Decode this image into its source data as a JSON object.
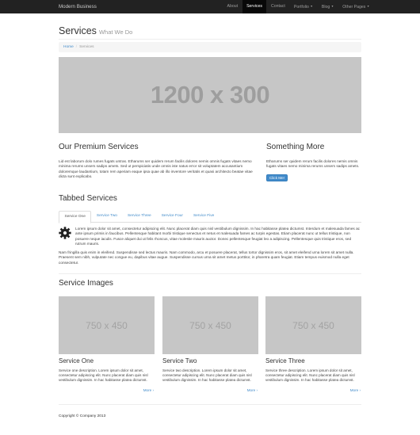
{
  "navbar": {
    "brand": "Modern Business",
    "links": [
      {
        "label": "About"
      },
      {
        "label": "Services"
      },
      {
        "label": "Contact"
      },
      {
        "label": "Portfolio"
      },
      {
        "label": "Blog"
      },
      {
        "label": "Other Pages"
      }
    ]
  },
  "header": {
    "title": "Services",
    "subtitle": "What We Do"
  },
  "breadcrumb": {
    "home": "Home",
    "current": "Services"
  },
  "hero": {
    "placeholder": "1200 x 300"
  },
  "premium": {
    "title": "Our Premium Services",
    "text": "Lid est laborum dolo rumes fugats untras. Etharums ser quidem rerum facilis dolores nemis omnis fugats vitaes nemo minima rerums unsers sadips amets. Sed ut perspiciatis unde omnis iste natus error sit voluptatem accusantium doloremque laudantium, totam rem aperiam eaque ipsa quae ab illo inventore veritatis et quasi architecto beatae vitae dicta sunt explicabo."
  },
  "something": {
    "title": "Something More",
    "text": "Etharums ser quidem rerum facilis dolores nemis omnis fugats vitaes nemo minima rerums unsers sadips amets.",
    "button": "Click Me!"
  },
  "tabbed": {
    "title": "Tabbed Services",
    "tabs": [
      "Service One",
      "Service Two",
      "Service Three",
      "Service Four",
      "Service Five"
    ],
    "para1": "Lorem ipsum dolor sit amet, consectetur adipiscing elit. Nunc placerat diam quis nisl vestibulum dignissim. In hac habitasse platea dictumst. Interdum et malesuada fames ac ante ipsum primis in faucibus. Pellentesque habitant morbi tristique senectus et netus et malesuada fames ac turpis egestas. Etiam placerat nunc ut tellus tristique, non posuere neque iaculis. Fusce aliquet dui ut felis rhoncus, vitae molestie mauris auctor. Donec pellentesque feugiat leo a adipiscing. Pellentesque quis tristique eros, sed rutrum mauris.",
    "para2": "Nam fringilla quis enim in eleifend. Suspendisse sed lectus mauris. Nam commodo, arcu et posuere placerat, tellus tortor dignissim eros, sit amet eleifend urna lorem sit amet nulla. Praesent sem nibh, vulputate nec congue eu, dapibus vitae augue. Suspendisse cursus urna sit amet metus porttitor, in pharetra quam feugiat. Etiam tempus euismod nulla eget consectetur."
  },
  "images": {
    "title": "Service Images",
    "cards": [
      {
        "placeholder": "750 x 450",
        "title": "Service One",
        "text": "Service one description. Lorem ipsum dolor sit amet, consectetur adipiscing elit. Nunc placerat diam quis nisl vestibulum dignissim. In hac habitasse platea dictumst.",
        "more": "More ›"
      },
      {
        "placeholder": "750 x 450",
        "title": "Service Two",
        "text": "Service two description. Lorem ipsum dolor sit amet, consectetur adipiscing elit. Nunc placerat diam quis nisl vestibulum dignissim. In hac habitasse platea dictumst.",
        "more": "More ›"
      },
      {
        "placeholder": "750 x 450",
        "title": "Service Three",
        "text": "Service three description. Lorem ipsum dolor sit amet, consectetur adipiscing elit. Nunc placerat diam quis nisl vestibulum dignissim. In hac habitasse platea dictumst.",
        "more": "More ›"
      }
    ]
  },
  "footer": {
    "copyright": "Copyright © Company 2013"
  },
  "colors": {
    "navbar": "#222222",
    "link": "#428bca",
    "placeholder": "#c6c6c6"
  }
}
